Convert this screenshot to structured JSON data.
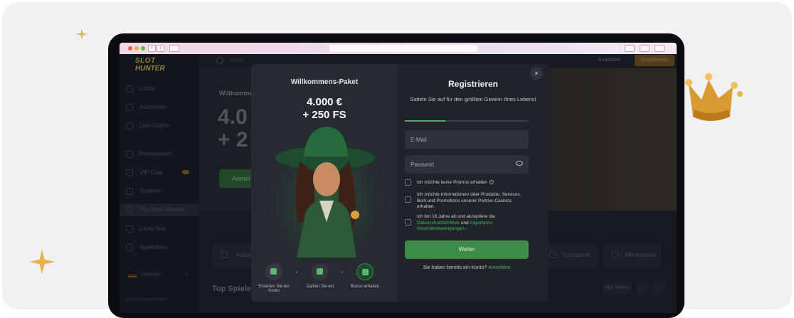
{
  "site": {
    "logo_line1": "SLOT",
    "logo_line2": "HUNTER",
    "search_label": "Suche",
    "login_label": "Anmelden",
    "register_label": "Registrieren",
    "sidebar": [
      {
        "label": "Lobby"
      },
      {
        "label": "Automaten"
      },
      {
        "label": "Live Casino"
      },
      {
        "label": "Promotionen"
      },
      {
        "label": "VIP-Club"
      },
      {
        "label": "Turniere"
      },
      {
        "label": "The Most Wanted"
      },
      {
        "label": "Lucky Box"
      },
      {
        "label": "Applikation"
      }
    ],
    "language": "German",
    "sidebar_footer": "Zahlungsmethoden",
    "hero_title": "Willkommens",
    "hero_amount_1": "4.0",
    "hero_amount_2": "+ 2",
    "hero_button": "Anmel",
    "categories": [
      {
        "label": "Autom"
      },
      {
        "label": "Tischspiele"
      },
      {
        "label": "Alle Anbieter"
      }
    ],
    "top_games_title": "Top Spiele",
    "see_all": "Alle Sehen",
    "prev_arrow": "‹",
    "next_arrow": "›"
  },
  "modal": {
    "welcome_title": "Willkommens-Paket",
    "bonus_amount": "4.000 €",
    "bonus_fs": "+ 250 FS",
    "steps": [
      {
        "label": "Erstellen Sie ein Konto"
      },
      {
        "label": "Zahlen Sie ein"
      },
      {
        "label": "Bonus erhalten"
      }
    ],
    "step_arrow": "›",
    "close_label": "×",
    "title": "Registrieren",
    "subtitle": "Satteln Sie auf für den größten Gewinn Ihres Lebens!",
    "progress_fraction": 0.33,
    "email_placeholder": "E-Mail",
    "password_placeholder": "Passwort",
    "check_promos": "Ich möchte keine Promos erhalten",
    "check_info": "Ich möchte Informationen über Produkte, Services, Boni und Promotions unserer Partner-Casinos erhalten.",
    "check_age_prefix": "Ich bin 18 Jahre alt und akzeptiere die",
    "check_age_link1": "Datenschutzrichtlinie",
    "check_age_and": "und",
    "check_age_link2": "Allgemeine Geschäftsbedingungen",
    "check_age_suffix": "›",
    "continue_button": "Weiter",
    "have_account": "Sie haben bereits ein Konto?",
    "login_link": "Anmelden"
  },
  "colors": {
    "accent_green": "#4caf5a",
    "background": "#f1f1f3",
    "device": "#0b0d10"
  }
}
